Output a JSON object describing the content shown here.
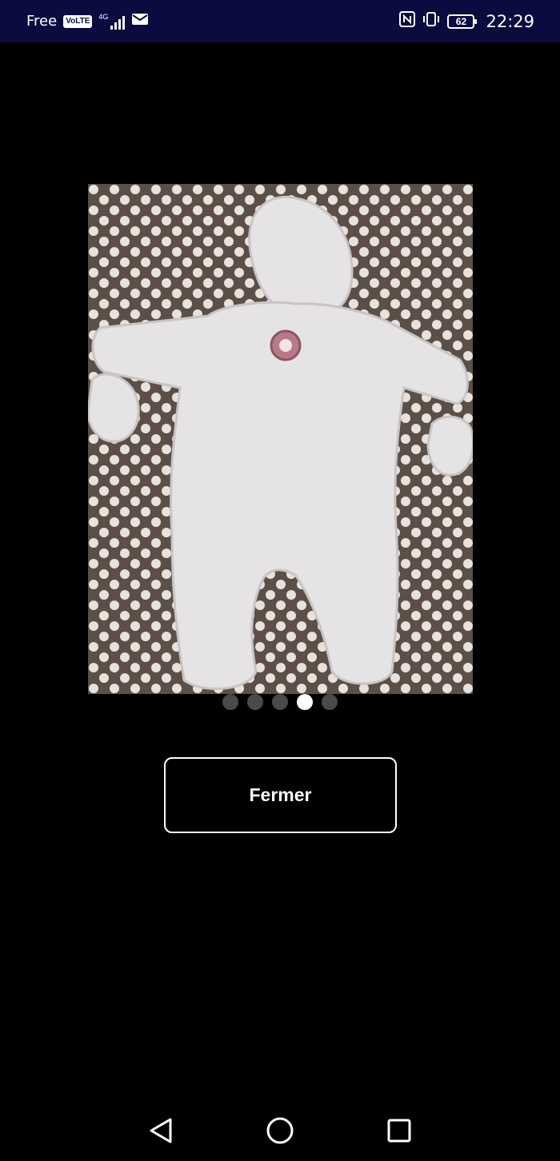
{
  "status_bar": {
    "carrier": "Free",
    "volte_label": "VoLTE",
    "network_type": "4G",
    "battery_level": "62",
    "time": "22:29",
    "icons": [
      "volte-icon",
      "signal-icon",
      "mail-icon",
      "nfc-icon",
      "vibrate-icon",
      "battery-icon"
    ]
  },
  "viewer": {
    "image_description_icon": "photo",
    "pager": {
      "total": 5,
      "active_index": 3
    }
  },
  "close_button": {
    "label": "Fermer"
  },
  "nav_bar": {
    "icons": [
      "back-icon",
      "home-icon",
      "recent-apps-icon"
    ]
  },
  "colors": {
    "status_bar_bg": "#0b0b3f",
    "background": "#000000",
    "dot_inactive": "#4a4a4a",
    "dot_active": "#ffffff"
  }
}
